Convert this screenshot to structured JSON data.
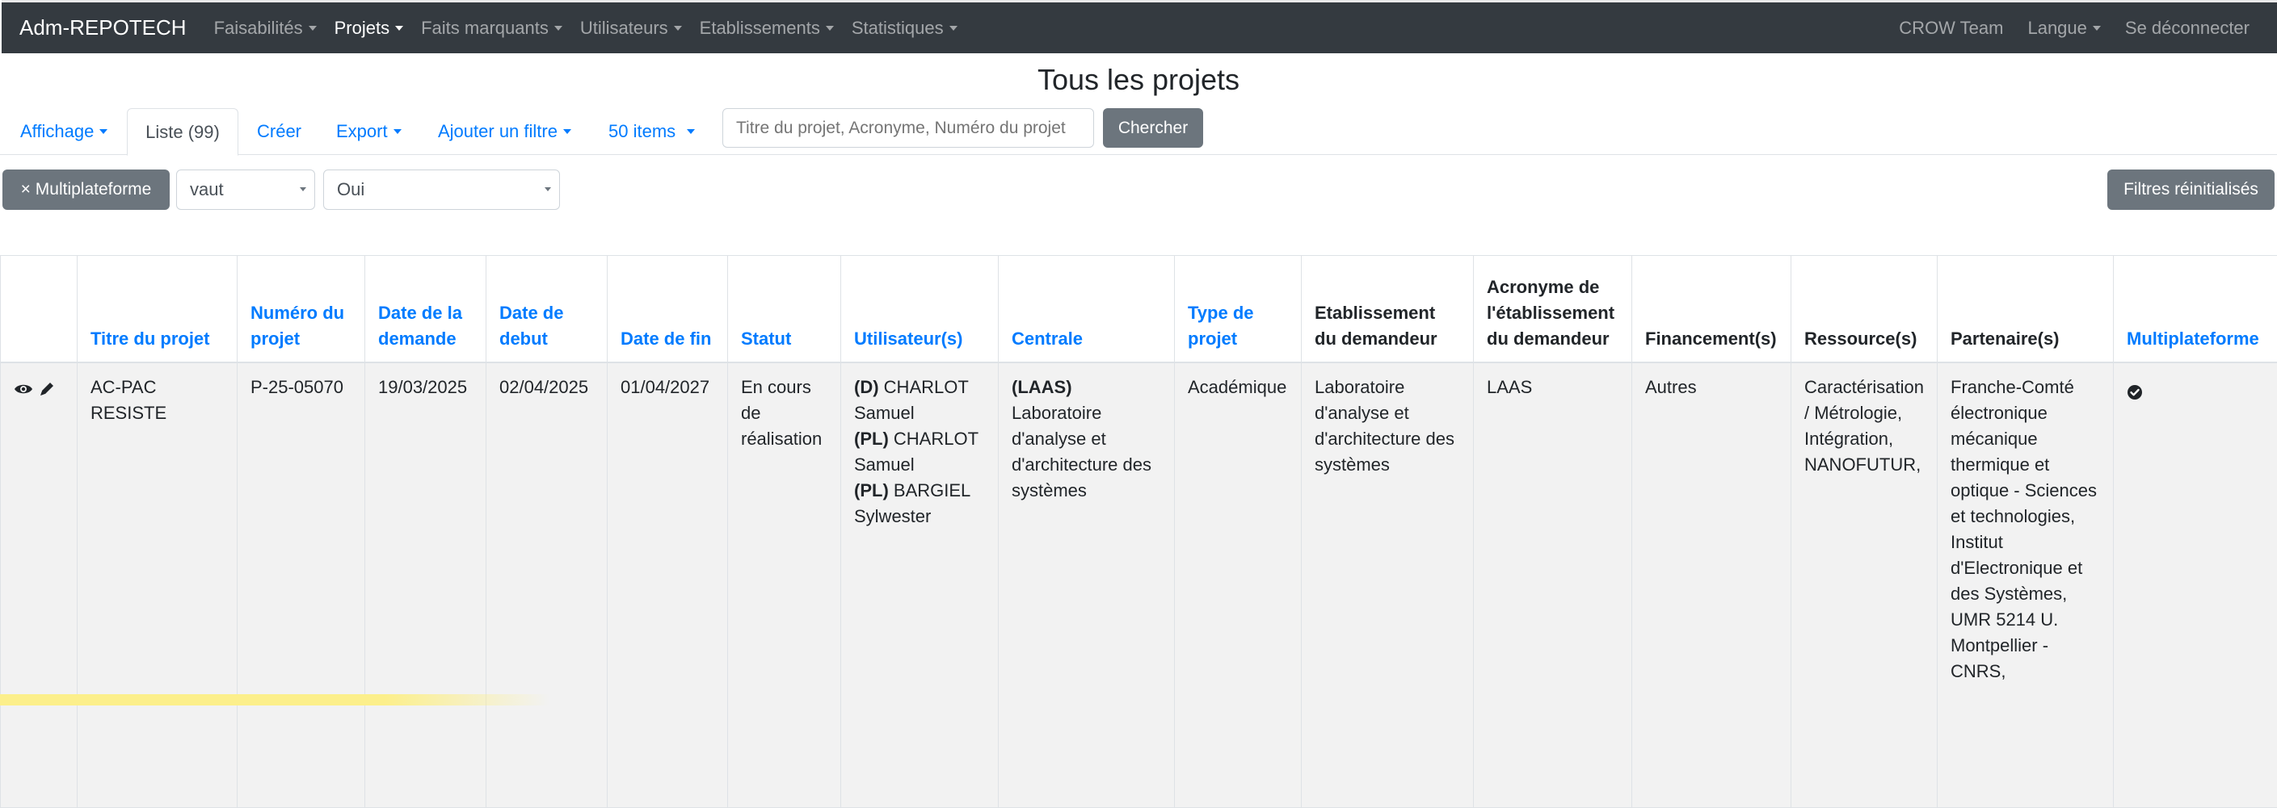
{
  "navbar": {
    "brand": "Adm-REPOTECH",
    "menu": [
      {
        "label": "Faisabilités",
        "active": false
      },
      {
        "label": "Projets",
        "active": true
      },
      {
        "label": "Faits marquants",
        "active": false
      },
      {
        "label": "Utilisateurs",
        "active": false
      },
      {
        "label": "Etablissements",
        "active": false
      },
      {
        "label": "Statistiques",
        "active": false
      }
    ],
    "right": {
      "team": "CROW Team",
      "language": "Langue",
      "logout": "Se déconnecter"
    }
  },
  "page": {
    "title": "Tous les projets"
  },
  "toolbar": {
    "display": "Affichage",
    "list_tab": "Liste (99)",
    "create": "Créer",
    "export": "Export",
    "add_filter": "Ajouter un filtre",
    "items_per_page": "50 items",
    "search_placeholder": "Titre du projet, Acronyme, Numéro du projet",
    "search_button": "Chercher"
  },
  "filter": {
    "chip": "× Multiplateforme",
    "operator": "vaut",
    "value": "Oui",
    "reset": "Filtres réinitialisés"
  },
  "table": {
    "headers": [
      "Titre du projet",
      "Numéro du projet",
      "Date de la demande",
      "Date de debut",
      "Date de fin",
      "Statut",
      "Utilisateur(s)",
      "Centrale",
      "Type de projet",
      "Etablissement du demandeur",
      "Acronyme de l'établissement du demandeur",
      "Financement(s)",
      "Ressource(s)",
      "Partenaire(s)",
      "Multiplateforme"
    ],
    "rows": [
      {
        "title": "AC-PAC RESISTE",
        "number": "P-25-05070",
        "request_date": "19/03/2025",
        "start_date": "02/04/2025",
        "end_date": "01/04/2027",
        "status": "En cours de réalisation",
        "users": [
          {
            "role": "(D)",
            "name": "CHARLOT Samuel"
          },
          {
            "role": "(PL)",
            "name": "CHARLOT Samuel"
          },
          {
            "role": "(PL)",
            "name": "BARGIEL Sylwester"
          }
        ],
        "centrale_code": "(LAAS)",
        "centrale_name": "Laboratoire d'analyse et d'architecture des systèmes",
        "project_type": "Académique",
        "establishment": "Laboratoire d'analyse et d'architecture des systèmes",
        "establishment_acronym": "LAAS",
        "funding": "Autres",
        "resources": "Caractérisation / Métrologie, Intégration, NANOFUTUR,",
        "partners": "Franche-Comté électronique mécanique thermique et optique - Sciences et technologies, Institut d'Electronique et des Systèmes, UMR 5214 U. Montpellier - CNRS,",
        "multiplatform_icon": "check-circle-icon"
      }
    ]
  }
}
